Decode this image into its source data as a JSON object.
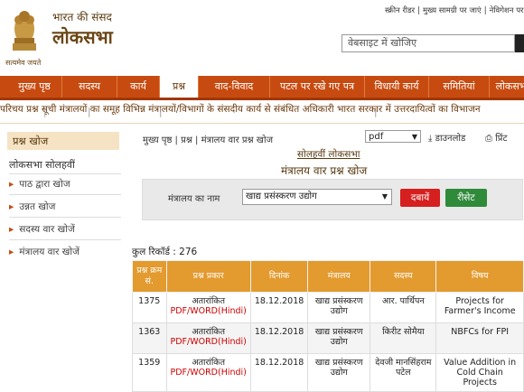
{
  "header": {
    "emblem_caption": "सत्यमेव जयते",
    "brand_sub": "भारत की संसद",
    "brand_main": "लोकसभा",
    "toplinks": [
      "स्क्रीन रीडर",
      "मुख्य सामग्री पर जाएं",
      "नेविगेशन पर जाएं"
    ],
    "search_placeholder": "वेबसाइट में खोजिए"
  },
  "nav": [
    "मुख्य पृष्ठ",
    "सदस्य",
    "कार्य",
    "प्रश्न",
    "वाद-विवाद",
    "पटल पर रखे गए पत्र",
    "विधायी कार्य",
    "समितियां",
    "लोकसभा"
  ],
  "subnav": [
    "परिचय",
    "प्रश्न सूची",
    "मंत्रालयों का समूह",
    "विभिन्न मंत्रालयों/विभागों के संसदीय कार्य से संबंधित अधिकारी",
    "भारत सरकार में उत्तरदायित्वों का विभाजन"
  ],
  "sidebar": {
    "header": "प्रश्न खोज",
    "title": "लोकसभा सोलहवीं",
    "links": [
      "पाठ द्वारा खोज",
      "उन्नत खोज",
      "सदस्य वार खोजें",
      "मंत्रालय वार खोजें"
    ]
  },
  "main": {
    "breadcrumb": "मुख्य पृष्ठ  |  प्रश्न  |  मंत्रालय वार प्रश्न खोज",
    "format": "pdf",
    "download": "डाउनलोड",
    "print": "प्रिंट",
    "heading_sub": "सोलहवीं लोकसभा",
    "heading_main": "मंत्रालय वार प्रश्न खोज",
    "ministry_label": "मंत्रालय का नाम",
    "ministry_value": "खाद्य प्रसंस्करण उद्योग",
    "search_button": "दबायें",
    "reset_button": "रीसेट",
    "total_records": "कुल रिकॉर्ड : 276"
  },
  "table": {
    "headers": [
      "प्रश्न क्रम सं.",
      "प्रश्न प्रकार",
      "दिनांक",
      "मंत्रालय",
      "सदस्य",
      "विषय"
    ],
    "rows": [
      {
        "no": "1375",
        "type": "अतारांकित",
        "links": "PDF/WORD(Hindi)",
        "date": "18.12.2018",
        "ministry": "खाद्य प्रसंस्करण उद्योग",
        "member": "आर. पार्थिपन",
        "subject": "Projects for Farmer's Income"
      },
      {
        "no": "1363",
        "type": "अतारांकित",
        "links": "PDF/WORD(Hindi)",
        "date": "18.12.2018",
        "ministry": "खाद्य प्रसंस्करण उद्योग",
        "member": "किरीट सोमैया",
        "subject": "NBFCs for FPI"
      },
      {
        "no": "1359",
        "type": "अतारांकित",
        "links": "PDF/WORD(Hindi)",
        "date": "18.12.2018",
        "ministry": "खाद्य प्रसंस्करण उद्योग",
        "member": "देवजी मानसिंहराम पटेल",
        "subject": "Value Addition in Cold Chain Projects"
      }
    ]
  }
}
